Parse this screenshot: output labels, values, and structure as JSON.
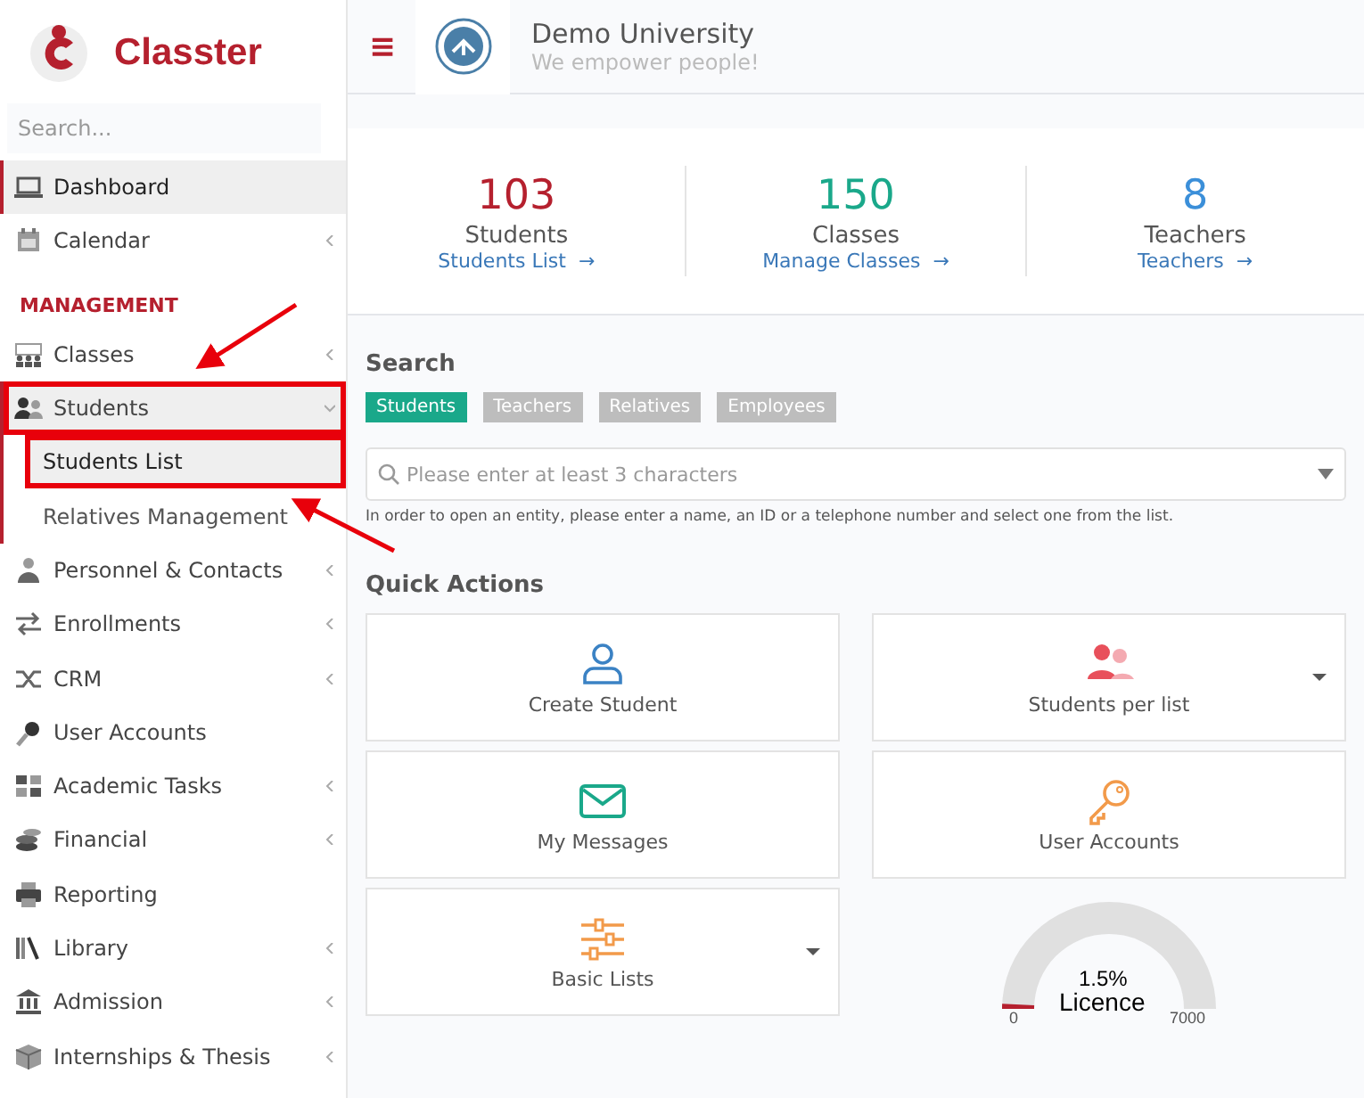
{
  "brand": {
    "name": "Classter"
  },
  "sidebar": {
    "search": {
      "placeholder": "Search..."
    },
    "sections": [
      {
        "items": [
          {
            "label": "Dashboard",
            "selected": true,
            "has_submenu": false,
            "expanded": false,
            "highlighted": false
          },
          {
            "label": "Calendar",
            "selected": false,
            "has_submenu": true,
            "expanded": false,
            "highlighted": false
          }
        ]
      },
      {
        "heading": "MANAGEMENT",
        "items": [
          {
            "label": "Classes",
            "selected": false,
            "has_submenu": true,
            "expanded": false,
            "highlighted": false
          },
          {
            "label": "Students",
            "selected": false,
            "has_submenu": true,
            "expanded": true,
            "highlighted": true,
            "children": [
              {
                "label": "Students List",
                "selected": true,
                "highlighted": true
              },
              {
                "label": "Relatives Management",
                "selected": false,
                "highlighted": false
              }
            ]
          },
          {
            "label": "Personnel & Contacts",
            "selected": false,
            "has_submenu": true,
            "expanded": false,
            "highlighted": false
          },
          {
            "label": "Enrollments",
            "selected": false,
            "has_submenu": true,
            "expanded": false,
            "highlighted": false
          },
          {
            "label": "CRM",
            "selected": false,
            "has_submenu": true,
            "expanded": false,
            "highlighted": false
          },
          {
            "label": "User Accounts",
            "selected": false,
            "has_submenu": false,
            "expanded": false,
            "highlighted": false
          },
          {
            "label": "Academic Tasks",
            "selected": false,
            "has_submenu": true,
            "expanded": false,
            "highlighted": false
          },
          {
            "label": "Financial",
            "selected": false,
            "has_submenu": true,
            "expanded": false,
            "highlighted": false
          },
          {
            "label": "Reporting",
            "selected": false,
            "has_submenu": false,
            "expanded": false,
            "highlighted": false
          },
          {
            "label": "Library",
            "selected": false,
            "has_submenu": true,
            "expanded": false,
            "highlighted": false
          },
          {
            "label": "Admission",
            "selected": false,
            "has_submenu": true,
            "expanded": false,
            "highlighted": false
          },
          {
            "label": "Internships & Thesis",
            "selected": false,
            "has_submenu": true,
            "expanded": false,
            "highlighted": false
          }
        ]
      }
    ]
  },
  "header": {
    "menu_icon": "≡",
    "title": "Demo University",
    "subtitle": "We empower people!"
  },
  "stats": [
    {
      "value": "103",
      "label": "Students",
      "link": "Students List",
      "arrow": "→",
      "color": "#b5202e"
    },
    {
      "value": "150",
      "label": "Classes",
      "link": "Manage Classes",
      "arrow": "→",
      "color": "#1aa88a"
    },
    {
      "value": "8",
      "label": "Teachers",
      "link": "Teachers",
      "arrow": "→",
      "color": "#3b8fd9"
    }
  ],
  "search": {
    "title": "Search",
    "tabs": [
      {
        "label": "Students",
        "selected": true
      },
      {
        "label": "Teachers",
        "selected": false
      },
      {
        "label": "Relatives",
        "selected": false
      },
      {
        "label": "Employees",
        "selected": false
      }
    ],
    "placeholder": "Please enter at least 3 characters",
    "help": "In order to open an entity, please enter a name, an ID or a telephone number and select one from the list."
  },
  "quick_actions": {
    "title": "Quick Actions",
    "items": [
      {
        "label": "Create Student",
        "dropdown": false
      },
      {
        "label": "Students per list",
        "dropdown": true
      },
      {
        "label": "My Messages",
        "dropdown": false
      },
      {
        "label": "User Accounts",
        "dropdown": false
      },
      {
        "label": "Basic Lists",
        "dropdown": true
      }
    ]
  },
  "licence": {
    "percent": "1.5%",
    "label": "Licence",
    "min": "0",
    "max": "7000",
    "level": 0.015
  }
}
